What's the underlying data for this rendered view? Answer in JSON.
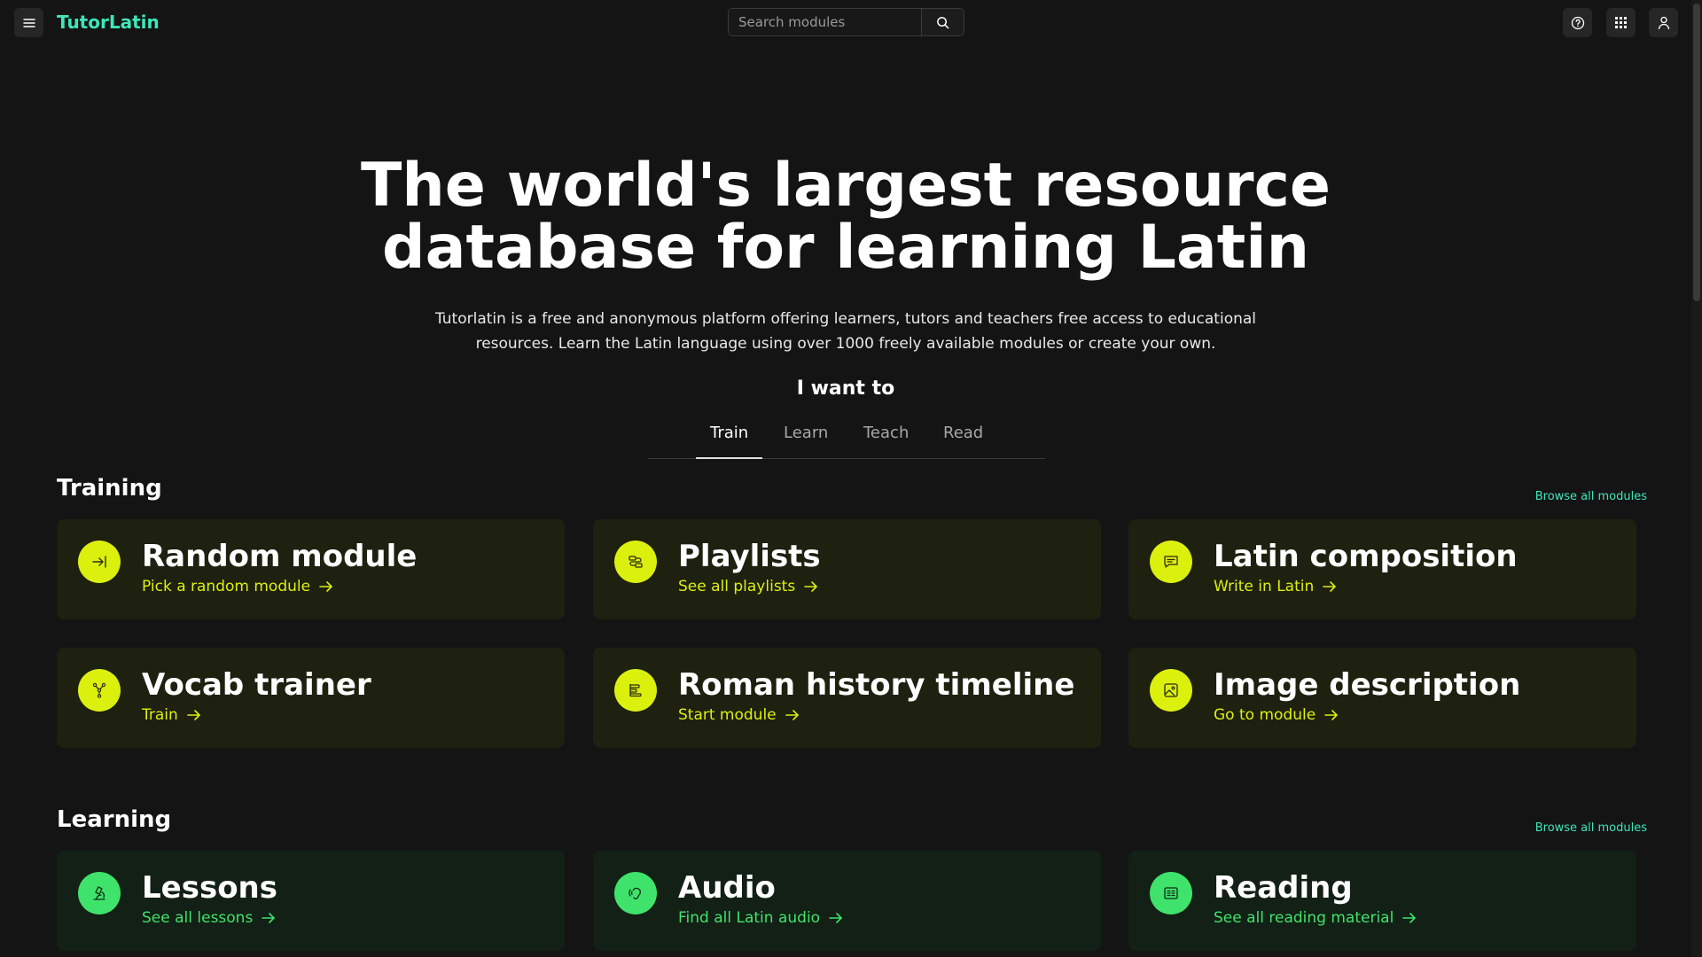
{
  "header": {
    "brand": "TutorLatin",
    "search_placeholder": "Search modules"
  },
  "hero": {
    "title_line1": "The world's largest resource",
    "title_line2": "database for learning Latin",
    "subtitle_line1": "Tutorlatin is a free and anonymous platform offering learners, tutors and teachers free access to educational",
    "subtitle_line2": "resources. Learn the Latin language using over 1000 freely available modules or create your own.",
    "want_label": "I want to"
  },
  "tabs": [
    "Train",
    "Learn",
    "Teach",
    "Read"
  ],
  "active_tab": "Train",
  "training": {
    "title": "Training",
    "browse": "Browse all modules",
    "cards": [
      {
        "title": "Random module",
        "link": "Pick a random module",
        "icon": "arrow-to-line-icon"
      },
      {
        "title": "Playlists",
        "link": "See all playlists",
        "icon": "playlist-route-icon"
      },
      {
        "title": "Latin composition",
        "link": "Write in Latin",
        "icon": "chat-message-icon"
      },
      {
        "title": "Vocab trainer",
        "link": "Train",
        "icon": "hierarchy-icon"
      },
      {
        "title": "Roman history timeline",
        "link": "Start module",
        "icon": "timeline-icon"
      },
      {
        "title": "Image description",
        "link": "Go to module",
        "icon": "image-icon"
      }
    ]
  },
  "learning": {
    "title": "Learning",
    "browse": "Browse all modules",
    "cards": [
      {
        "title": "Lessons",
        "link": "See all lessons",
        "icon": "microscope-icon"
      },
      {
        "title": "Audio",
        "link": "Find all Latin audio",
        "icon": "ear-icon"
      },
      {
        "title": "Reading",
        "link": "See all reading material",
        "icon": "newspaper-icon"
      }
    ]
  },
  "colors": {
    "brand": "#3ee6b8",
    "training_accent": "#dcf00e",
    "learning_accent": "#3fe36b",
    "background": "#141414"
  }
}
